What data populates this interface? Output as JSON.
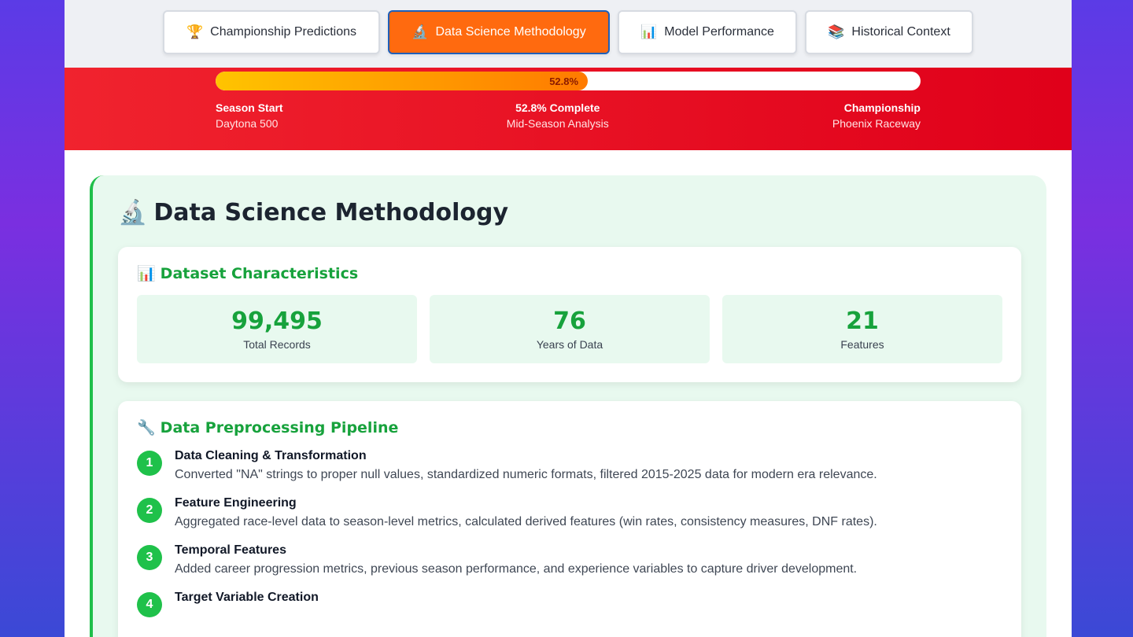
{
  "tabs": [
    {
      "icon": "🏆",
      "label": "Championship Predictions",
      "active": false
    },
    {
      "icon": "🔬",
      "label": "Data Science Methodology",
      "active": true
    },
    {
      "icon": "📊",
      "label": "Model Performance",
      "active": false
    },
    {
      "icon": "📚",
      "label": "Historical Context",
      "active": false
    }
  ],
  "progress": {
    "value_percent": 52.8,
    "label": "52.8%",
    "start": {
      "title": "Season Start",
      "subtitle": "Daytona 500"
    },
    "middle": {
      "title": "52.8% Complete",
      "subtitle": "Mid-Season Analysis"
    },
    "end": {
      "title": "Championship",
      "subtitle": "Phoenix Raceway"
    },
    "colors": {
      "band": "#e8001c",
      "fill_start": "#ffc400",
      "fill_end": "#ff7a00"
    }
  },
  "section": {
    "icon": "🔬",
    "title": "Data Science Methodology"
  },
  "dataset": {
    "icon": "📊",
    "title": "Dataset Characteristics",
    "stats": [
      {
        "value": "99,495",
        "label": "Total Records"
      },
      {
        "value": "76",
        "label": "Years of Data"
      },
      {
        "value": "21",
        "label": "Features"
      }
    ]
  },
  "pipeline": {
    "icon": "🔧",
    "title": "Data Preprocessing Pipeline",
    "steps": [
      {
        "num": "1",
        "title": "Data Cleaning & Transformation",
        "desc": "Converted \"NA\" strings to proper null values, standardized numeric formats, filtered 2015-2025 data for modern era relevance."
      },
      {
        "num": "2",
        "title": "Feature Engineering",
        "desc": "Aggregated race-level data to season-level metrics, calculated derived features (win rates, consistency measures, DNF rates)."
      },
      {
        "num": "3",
        "title": "Temporal Features",
        "desc": "Added career progression metrics, previous season performance, and experience variables to capture driver development."
      },
      {
        "num": "4",
        "title": "Target Variable Creation",
        "desc": ""
      }
    ]
  },
  "colors": {
    "accent_green": "#17a23c",
    "active_tab": "#ff6a0f"
  }
}
